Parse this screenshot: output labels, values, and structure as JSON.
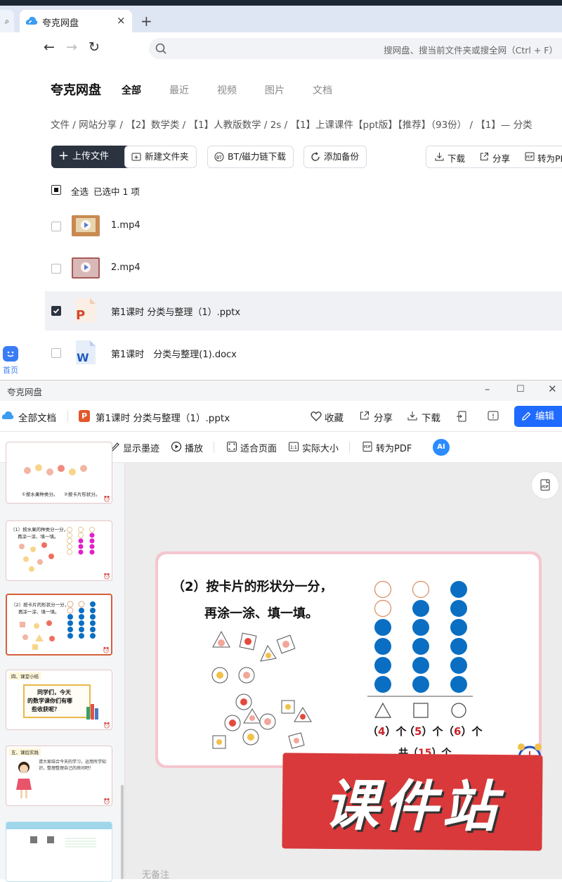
{
  "browser": {
    "tab_title": "夸克网盘",
    "address_placeholder": "搜网盘、搜当前文件夹或搜全网（Ctrl + F）"
  },
  "filemanager": {
    "brand": "夸克网盘",
    "nav_tabs": [
      "全部",
      "最近",
      "视频",
      "图片",
      "文档"
    ],
    "active_tab": "全部",
    "breadcrumb": "文件 / 网站分享 / 【2】数学类 / 【1】人教版数学 / 2s / 【1】上课课件【ppt版】【推荐】（93份） / 【1】— 分类",
    "toolbar": {
      "upload": "上传文件",
      "new_folder": "新建文件夹",
      "bt_download": "BT/磁力链下载",
      "add_backup": "添加备份",
      "download": "下载",
      "share": "分享",
      "to_pdf": "转为PDF"
    },
    "select_all": "全选",
    "selected_info": "已选中  1  项",
    "files": [
      {
        "name": "1.mp4",
        "type": "video",
        "checked": false
      },
      {
        "name": "2.mp4",
        "type": "video",
        "checked": false
      },
      {
        "name": "第1课时 分类与整理（1）.pptx",
        "type": "pptx",
        "checked": true
      },
      {
        "name": "第1课时　分类与整理(1).docx",
        "type": "docx",
        "checked": false
      }
    ],
    "home_label": "首页"
  },
  "viewer": {
    "window_title": "夸克网盘",
    "all_docs": "全部文档",
    "file_name": "第1课时 分类与整理（1）.pptx",
    "favorite": "收藏",
    "share": "分享",
    "download": "下载",
    "edit": "编辑",
    "tools": {
      "show_ink": "显示墨迹",
      "play": "播放",
      "fit_page": "适合页面",
      "actual_size": "实际大小",
      "to_pdf": "转为PDF",
      "ai": "AI"
    },
    "no_notes": "无备注",
    "thumbnails": {
      "t1_caption_a": "①按水果种类分。",
      "t1_caption_b": "②按卡片形状分。",
      "t2_title": "（1）按水果的种类分一分，",
      "t2_sub": "再涂一涂、填一填。",
      "t3_title": "（2）按卡片的形状分一分，",
      "t3_sub": "再涂一涂、填一填。",
      "t4_header": "四、课堂小结",
      "t4_body_1": "同学们，今天",
      "t4_body_2": "的数学课你们有哪",
      "t4_body_3": "些收获呢？",
      "t5_header": "五、课后实践",
      "t5_body": "请大家结合今天的学习，运用所学知识，整理整理自己的房间吧！"
    },
    "slide": {
      "title_line1": "（2）按卡片的形状分一分，",
      "title_line2": "再涂一涂、填一填。",
      "counts": [
        {
          "value": "4",
          "unit": "个"
        },
        {
          "value": "5",
          "unit": "个"
        },
        {
          "value": "6",
          "unit": "个"
        }
      ],
      "total_prefix": "共（",
      "total_value": "15",
      "total_suffix": "）个",
      "watermark": "课件站"
    },
    "colors": {
      "accent_blue": "#1f6bff",
      "bead_blue": "#0a6fc2",
      "bead_empty_stroke": "#d88a5e",
      "count_red": "#c8242a"
    }
  }
}
